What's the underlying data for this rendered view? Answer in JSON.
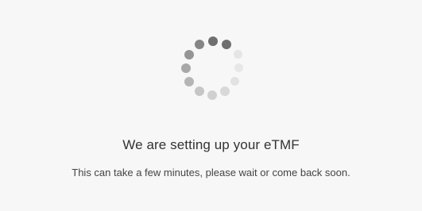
{
  "loading": {
    "title": "We are setting up your eTMF",
    "message": "This can take a few minutes, please wait or come back soon.",
    "spinner_icon": "loading-spinner-icon"
  },
  "colors": {
    "background": "#f7f7f7",
    "title_text": "#333333",
    "message_text": "#444444",
    "spinner_dark": "#6e6e6e",
    "spinner_light": "#e6e6e6"
  }
}
